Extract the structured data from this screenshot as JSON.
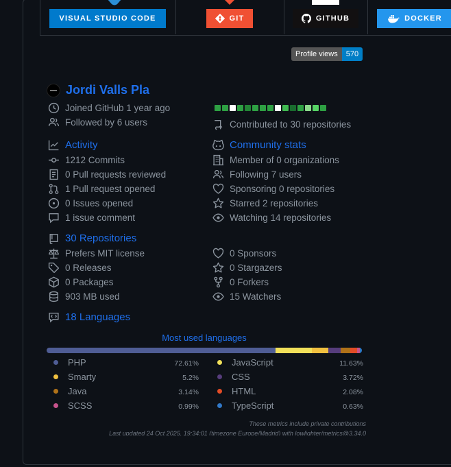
{
  "badges": [
    {
      "label": "VISUAL STUDIO CODE",
      "bg": "#007acc",
      "icon": "vscode-icon"
    },
    {
      "label": "GIT",
      "bg": "#f05033",
      "icon": "git-icon"
    },
    {
      "label": "GITHUB",
      "bg": "#121011",
      "icon": "github-icon"
    },
    {
      "label": "DOCKER",
      "bg": "#2496ed",
      "icon": "docker-icon"
    }
  ],
  "profile_views": {
    "label": "Profile views",
    "count": "570"
  },
  "user": {
    "name": "Jordi Valls Pla",
    "joined": "Joined GitHub 1 year ago",
    "followers": "Followed by 6 users",
    "contributed": "Contributed to 30 repositories"
  },
  "calendar": [
    "#2ea043",
    "#2ea043",
    "#ffffff",
    "#2ea043",
    "#238636",
    "#2ea043",
    "#2ea043",
    "#2ea043",
    "#ffffff",
    "#3fb950",
    "#196c2e",
    "#2ea043",
    "#8ddb8c",
    "#56d364",
    "#2ea043"
  ],
  "activity": {
    "title": "Activity",
    "items": [
      "1212 Commits",
      "0 Pull requests reviewed",
      "1 Pull request opened",
      "0 Issues opened",
      "1 issue comment"
    ]
  },
  "community": {
    "title": "Community stats",
    "items": [
      "Member of 0 organizations",
      "Following 7 users",
      "Sponsoring 0 repositories",
      "Starred 2 repositories",
      "Watching 14 repositories"
    ]
  },
  "repositories": {
    "title": "30 Repositories",
    "left": [
      "Prefers MIT license",
      "0 Releases",
      "0 Packages",
      "903 MB used"
    ],
    "right": [
      "0 Sponsors",
      "0 Stargazers",
      "0 Forkers",
      "15 Watchers"
    ]
  },
  "languages": {
    "title": "18 Languages",
    "chart_title": "Most used languages",
    "items": [
      {
        "name": "PHP",
        "pct": "72.61%",
        "value": 72.61,
        "color": "#4f5d95"
      },
      {
        "name": "JavaScript",
        "pct": "11.63%",
        "value": 11.63,
        "color": "#f1e05a"
      },
      {
        "name": "Smarty",
        "pct": "5.2%",
        "value": 5.2,
        "color": "#f0c040"
      },
      {
        "name": "CSS",
        "pct": "3.72%",
        "value": 3.72,
        "color": "#563d7c"
      },
      {
        "name": "Java",
        "pct": "3.14%",
        "value": 3.14,
        "color": "#b07219"
      },
      {
        "name": "HTML",
        "pct": "2.08%",
        "value": 2.08,
        "color": "#e34c26"
      },
      {
        "name": "SCSS",
        "pct": "0.99%",
        "value": 0.99,
        "color": "#c6538c"
      },
      {
        "name": "TypeScript",
        "pct": "0.63%",
        "value": 0.63,
        "color": "#3178c6"
      }
    ]
  },
  "footer": {
    "note": "These metrics include private contributions",
    "updated": "Last updated 24 Oct 2025, 19:34:01 (timezone Europe/Madrid) with lowlighter/metrics@3.34.0"
  }
}
